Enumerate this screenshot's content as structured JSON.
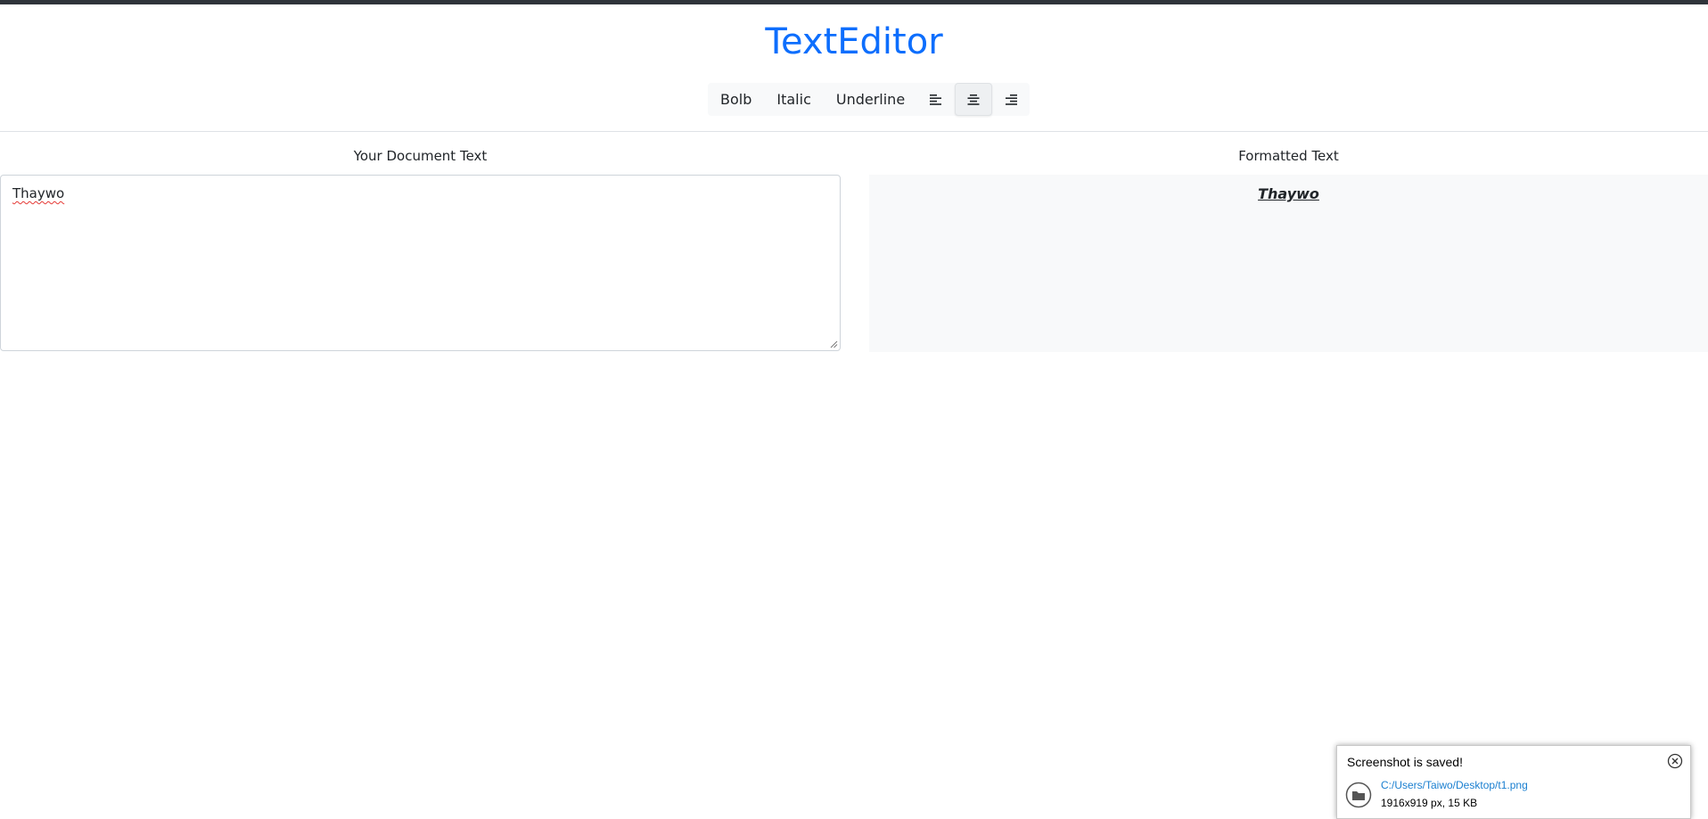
{
  "app": {
    "title": "TextEditor",
    "brand_color": "#0d6efd"
  },
  "toolbar": {
    "bold_label": "Bolb",
    "italic_label": "Italic",
    "underline_label": "Underline",
    "align_buttons": [
      {
        "icon": "align-left-icon",
        "active": false
      },
      {
        "icon": "align-center-icon",
        "active": true
      },
      {
        "icon": "align-right-icon",
        "active": false
      }
    ]
  },
  "editor": {
    "label": "Your Document Text",
    "value": "Thaywo"
  },
  "preview": {
    "label": "Formatted Text",
    "text": "Thaywo"
  },
  "toast": {
    "title": "Screenshot is saved!",
    "path": "C:/Users/Taiwo/Desktop/t1.png",
    "meta": "1916x919 px, 15 KB",
    "icons": [
      "close-icon",
      "folder-icon"
    ]
  }
}
